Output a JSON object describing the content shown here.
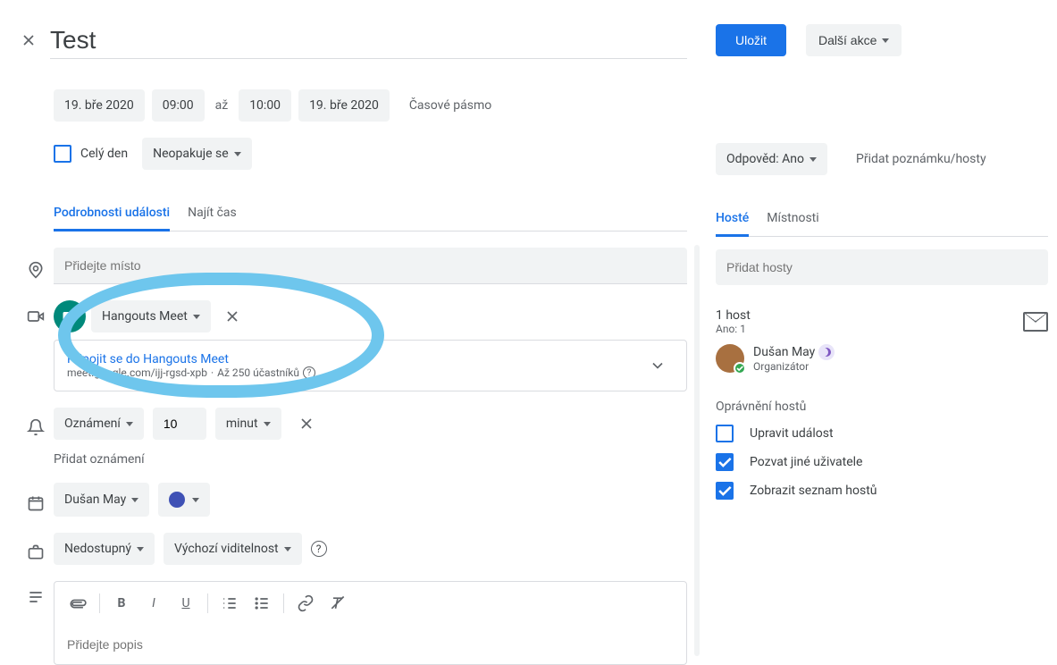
{
  "title": "Test",
  "save_label": "Uložit",
  "more_label": "Další akce",
  "date_start": "19. bře 2020",
  "time_start": "09:00",
  "to_word": "až",
  "time_end": "10:00",
  "date_end": "19. bře 2020",
  "timezone_label": "Časové pásmo",
  "allday_label": "Celý den",
  "recurrence_label": "Neopakuje se",
  "response_label": "Odpověd: Ano",
  "note_link": "Přidat poznámku/hosty",
  "tabs_left": [
    "Podrobnosti události",
    "Najít čas"
  ],
  "tabs_right": [
    "Hosté",
    "Místnosti"
  ],
  "location_placeholder": "Přidejte místo",
  "meet_label": "Hangouts Meet",
  "meet_join": "Připojit se do Hangouts Meet",
  "meet_url": "meet.google.com/ijj-rgsd-xpb",
  "meet_capacity": "Až 250 účastníků",
  "notification_label": "Oznámení",
  "notification_value": "10",
  "notification_unit": "minut",
  "add_notification": "Přidat oznámení",
  "calendar_owner": "Dušan May",
  "availability_label": "Nedostupný",
  "visibility_label": "Výchozí viditelnost",
  "description_placeholder": "Přidejte popis",
  "guest_placeholder": "Přidat hosty",
  "guest_count": "1 host",
  "guest_yes": "Ano: 1",
  "guest_name": "Dušan May",
  "guest_role": "Organizátor",
  "permissions_title": "Oprávnění hostů",
  "perm_edit": "Upravit událost",
  "perm_invite": "Pozvat jiné uživatele",
  "perm_see": "Zobrazit seznam hostů"
}
